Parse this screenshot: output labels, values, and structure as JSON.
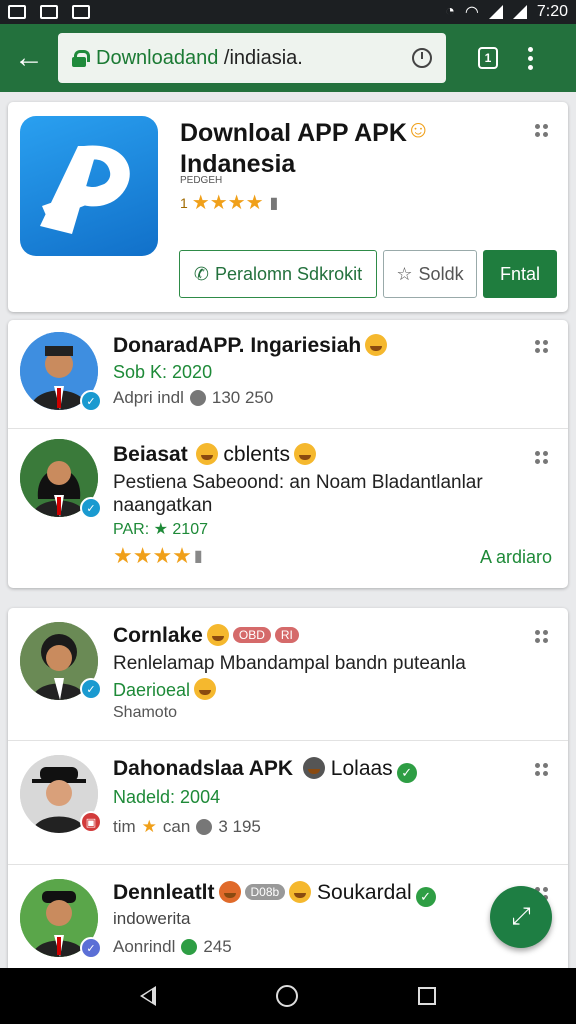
{
  "status": {
    "time": "7:20"
  },
  "browser": {
    "url_main": "Downloadand",
    "url_rest": " /indiasia.",
    "tab_label": "1"
  },
  "app": {
    "title_line1": "Downloal APP APK",
    "title_line2": "Indanesia",
    "sub": "PEDGEH",
    "rating_num": "1",
    "btn_primary": "Peralomn Sdkrokit",
    "btn_star": "Soldk",
    "btn_fill": "Fntal"
  },
  "items": [
    {
      "name": "DonaradAPP. Ingariesiah",
      "line2": "Sob K: 2020",
      "line3": "Adpri indl",
      "count": "130 250"
    },
    {
      "name_bold": "Beiasat",
      "name_rest": "cblents",
      "desc": "Pestiena Sabeoond: an Noam Bladantlanlar naangatkan",
      "meta": "PAR: ★ 2107",
      "link": "A ardiaro"
    }
  ],
  "items2": [
    {
      "name": "Cornlake",
      "tag1": "OBD",
      "tag2": "RI",
      "desc": "Renlelamap Mbandampal bandn puteanla",
      "line2": "Daerioeal",
      "line3": "Shamoto"
    },
    {
      "name": "Dahonadslaa APK",
      "name_tail": "Lolaas",
      "line2": "Nadeld: 2004",
      "line3a": "tim",
      "line3b": "can",
      "count": "3 195"
    },
    {
      "name": "Dennleatlt",
      "tag": "D08b",
      "name_tail": "Soukardal",
      "line2": "indowerita",
      "line3": "Aonrindl",
      "count": "245"
    }
  ],
  "colors": {
    "toolbar": "#23713d",
    "accent": "#1e8a38",
    "star": "#f0a01a"
  }
}
